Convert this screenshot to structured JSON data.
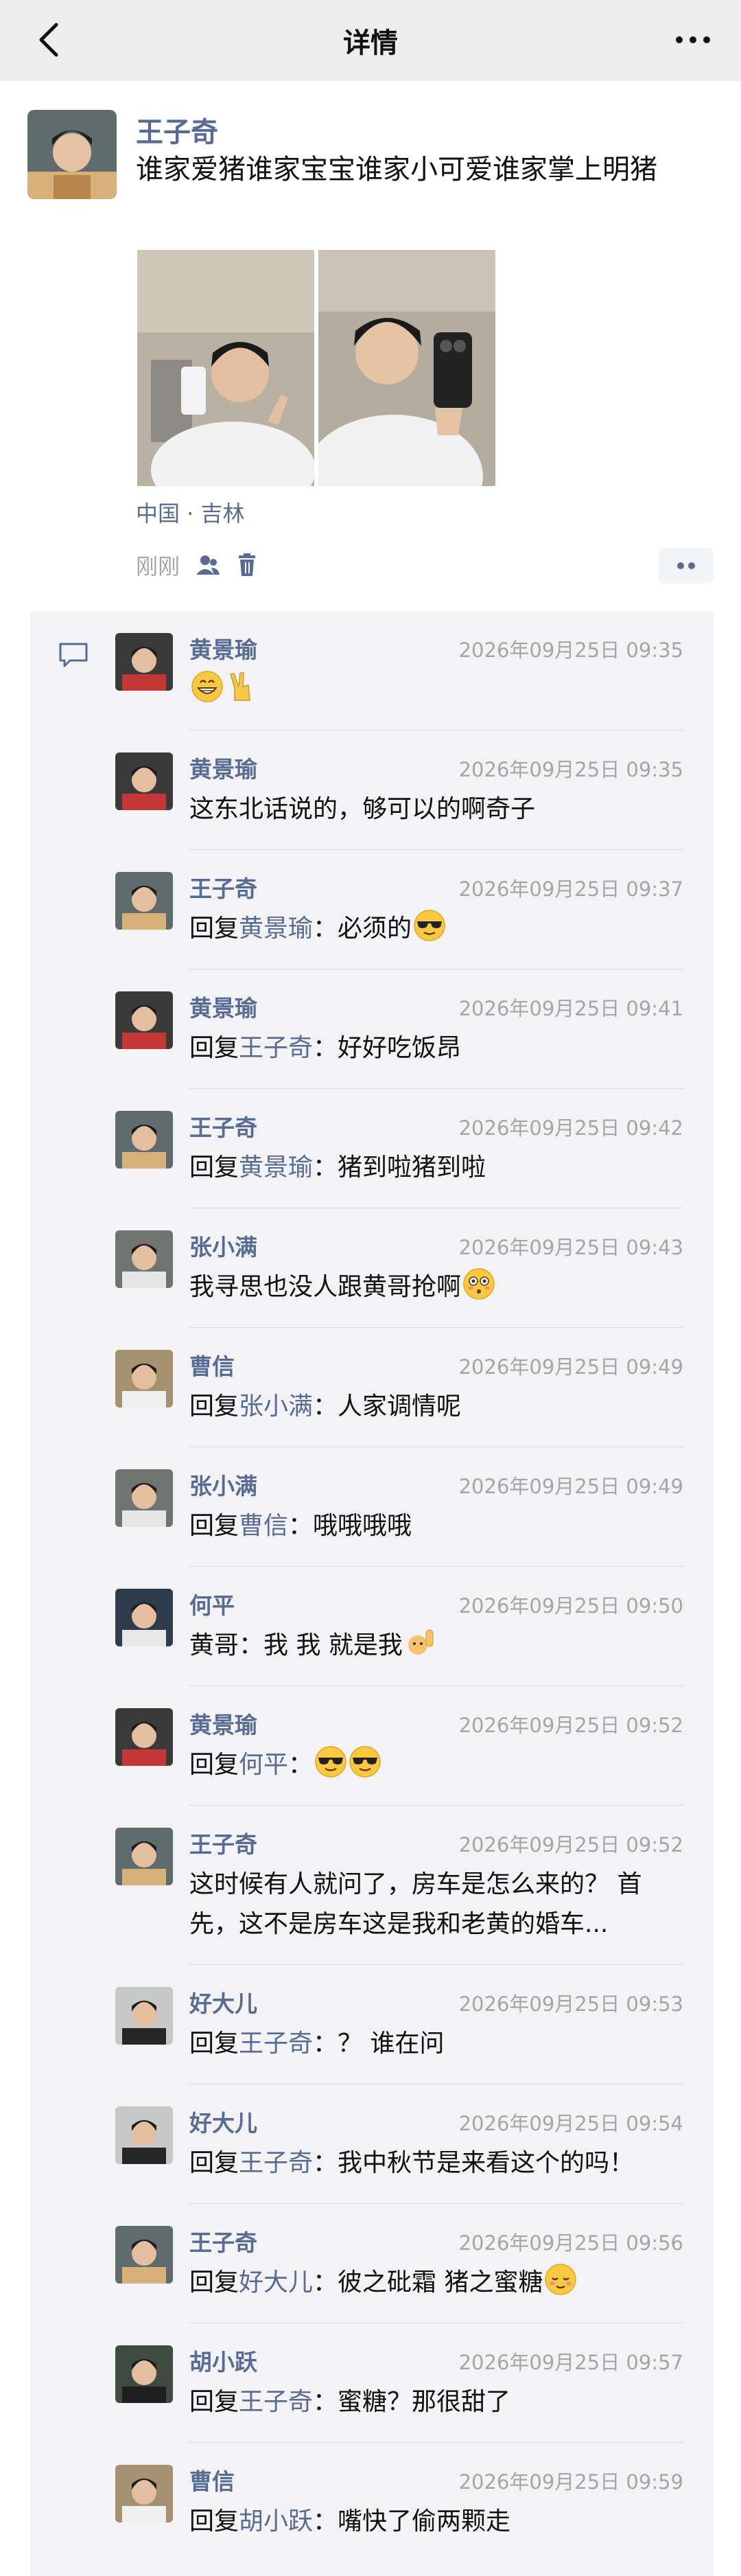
{
  "nav": {
    "title": "详情"
  },
  "post": {
    "author": "王子奇",
    "text": "谁家爱猪谁家宝宝谁家小可爱谁家掌上明猪",
    "location": "中国 · 吉林",
    "time": "刚刚"
  },
  "comments": [
    {
      "name": "黄景瑜",
      "time": "2026年09月25日 09:35",
      "reply_prefix": "",
      "reply_to": "",
      "text": "",
      "emojis": [
        "grin",
        "victory"
      ]
    },
    {
      "name": "黄景瑜",
      "time": "2026年09月25日 09:35",
      "reply_prefix": "",
      "reply_to": "",
      "text": "这东北话说的，够可以的啊奇子",
      "emojis": []
    },
    {
      "name": "王子奇",
      "time": "2026年09月25日 09:37",
      "reply_prefix": "回复",
      "reply_to": "黄景瑜",
      "text": "：必须的",
      "emojis": [
        "sunglasses"
      ]
    },
    {
      "name": "黄景瑜",
      "time": "2026年09月25日 09:41",
      "reply_prefix": "回复",
      "reply_to": "王子奇",
      "text": "：好好吃饭昂",
      "emojis": []
    },
    {
      "name": "王子奇",
      "time": "2026年09月25日 09:42",
      "reply_prefix": "回复",
      "reply_to": "黄景瑜",
      "text": "：猪到啦猪到啦",
      "emojis": []
    },
    {
      "name": "张小满",
      "time": "2026年09月25日 09:43",
      "reply_prefix": "",
      "reply_to": "",
      "text": "我寻思也没人跟黄哥抢啊",
      "emojis": [
        "flushed"
      ]
    },
    {
      "name": "曹信",
      "time": "2026年09月25日 09:49",
      "reply_prefix": "回复",
      "reply_to": "张小满",
      "text": "：人家调情呢",
      "emojis": []
    },
    {
      "name": "张小满",
      "time": "2026年09月25日 09:49",
      "reply_prefix": "回复",
      "reply_to": "曹信",
      "text": "：哦哦哦哦",
      "emojis": []
    },
    {
      "name": "何平",
      "time": "2026年09月25日 09:50",
      "reply_prefix": "",
      "reply_to": "",
      "text": "黄哥：我 我 就是我",
      "emojis": [
        "raise-hand"
      ]
    },
    {
      "name": "黄景瑜",
      "time": "2026年09月25日 09:52",
      "reply_prefix": "回复",
      "reply_to": "何平",
      "text": "：",
      "emojis": [
        "sunglasses",
        "sunglasses"
      ]
    },
    {
      "name": "王子奇",
      "time": "2026年09月25日 09:52",
      "reply_prefix": "",
      "reply_to": "",
      "text": "这时候有人就问了，房车是怎么来的？ 首先，这不是房车这是我和老黄的婚车...",
      "emojis": []
    },
    {
      "name": "好大儿",
      "time": "2026年09月25日 09:53",
      "reply_prefix": "回复",
      "reply_to": "王子奇",
      "text": "：？ 谁在问",
      "emojis": []
    },
    {
      "name": "好大儿",
      "time": "2026年09月25日 09:54",
      "reply_prefix": "回复",
      "reply_to": "王子奇",
      "text": "：我中秋节是来看这个的吗！",
      "emojis": []
    },
    {
      "name": "王子奇",
      "time": "2026年09月25日 09:56",
      "reply_prefix": "回复",
      "reply_to": "好大儿",
      "text": "：彼之砒霜 猪之蜜糖",
      "emojis": [
        "relieved"
      ]
    },
    {
      "name": "胡小跃",
      "time": "2026年09月25日 09:57",
      "reply_prefix": "回复",
      "reply_to": "王子奇",
      "text": "：蜜糖？那很甜了",
      "emojis": []
    },
    {
      "name": "曹信",
      "time": "2026年09月25日 09:59",
      "reply_prefix": "回复",
      "reply_to": "胡小跃",
      "text": "：嘴快了偷两颗走",
      "emojis": []
    }
  ]
}
